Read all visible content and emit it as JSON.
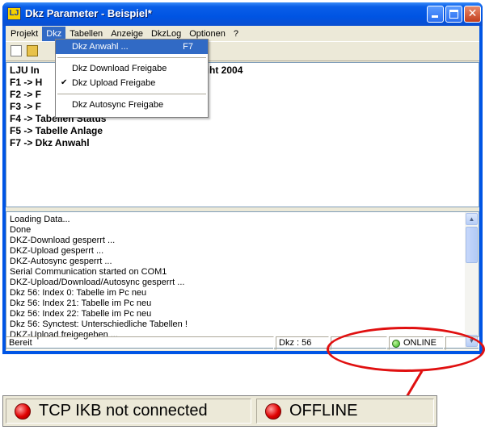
{
  "window": {
    "title": "Dkz Parameter - Beispiel*"
  },
  "menubar": [
    "Projekt",
    "Dkz",
    "Tabellen",
    "Anzeige",
    "DkzLog",
    "Optionen",
    "?"
  ],
  "dropdown": {
    "items": [
      {
        "label": "Dkz Anwahl ...",
        "shortcut": "F7",
        "selected": true
      },
      {
        "label": "Dkz Download Freigabe",
        "checked": false
      },
      {
        "label": "Dkz Upload Freigabe",
        "checked": true
      },
      {
        "label": "Dkz Autosync Freigabe",
        "checked": false
      }
    ]
  },
  "info_lines": [
    "LJU In",
    "pyright 2004",
    "F1 -> H",
    "F2 -> F",
    "F3 -> F",
    "F4 -> Tabellen Status",
    "F5 -> Tabelle Anlage",
    "F7 -> Dkz Anwahl"
  ],
  "log_lines": [
    "Loading Data...",
    "Done",
    "DKZ-Download gesperrt ...",
    "DKZ-Upload gesperrt ...",
    "DKZ-Autosync gesperrt ...",
    "Serial Communication started on COM1",
    "DKZ-Upload/Download/Autosync gesperrt ...",
    "Dkz 56: Index 0: Tabelle im Pc neu",
    "Dkz 56: Index 21: Tabelle im Pc neu",
    "Dkz 56: Index 22: Tabelle im Pc neu",
    "Dkz 56: Synctest: Unterschiedliche Tabellen !",
    "DKZ-Upload freigegeben ..."
  ],
  "statusbar": {
    "ready": "Bereit",
    "dkz": "Dkz : 56",
    "online": "ONLINE"
  },
  "zoom": {
    "tcp": "TCP IKB not connected",
    "offline": "OFFLINE"
  },
  "colors": {
    "led_online": "#30b51a",
    "led_offline": "#e00000",
    "annotation": "#e01010"
  }
}
